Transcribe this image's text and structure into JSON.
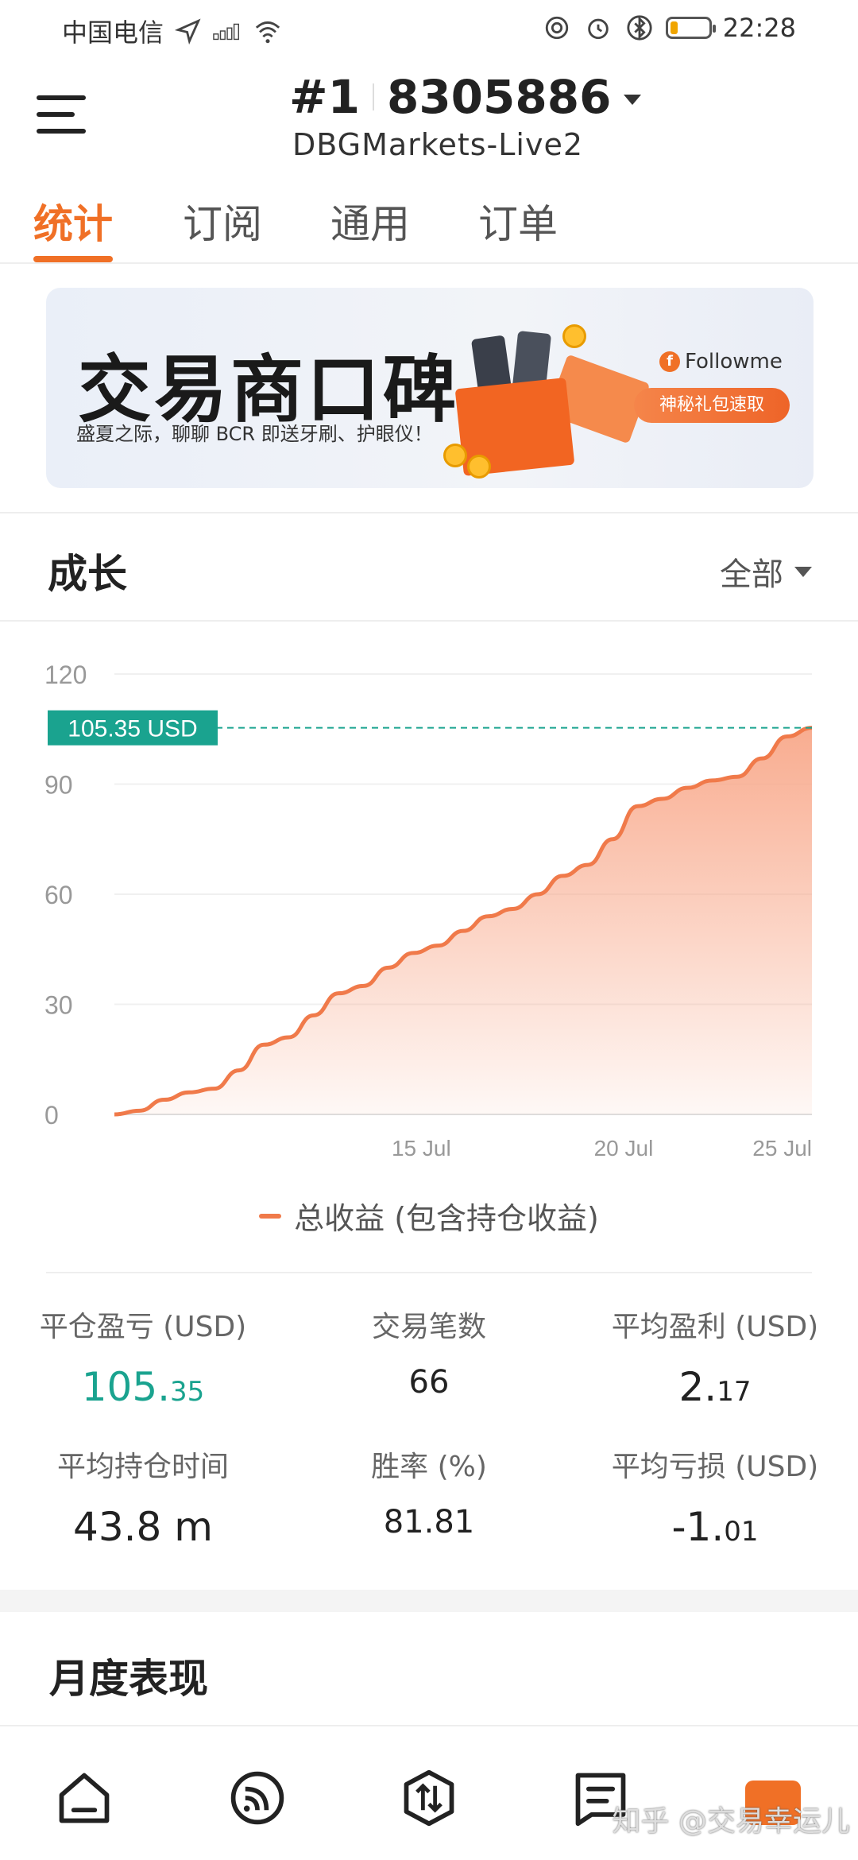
{
  "status_bar": {
    "carrier": "中国电信",
    "signal": "4G",
    "time": "22:28",
    "battery_level": 0.18
  },
  "header": {
    "account_rank": "#1",
    "account_number": "8305886",
    "server": "DBGMarkets-Live2"
  },
  "tabs": [
    {
      "label": "统计",
      "active": true
    },
    {
      "label": "订阅",
      "active": false
    },
    {
      "label": "通用",
      "active": false
    },
    {
      "label": "订单",
      "active": false
    }
  ],
  "banner": {
    "title": "交易商口碑",
    "subtitle": "盛夏之际，聊聊 BCR 即送牙刷、护眼仪！",
    "brand": "Followme",
    "button": "神秘礼包速取"
  },
  "growth": {
    "title": "成长",
    "filter": "全部"
  },
  "chart_data": {
    "type": "area",
    "ylim": [
      0,
      120
    ],
    "yticks": [
      "120",
      "90",
      "60",
      "30",
      "0"
    ],
    "xticks": [
      "15 Jul",
      "20 Jul",
      "25 Jul"
    ],
    "current_label": "105.35 USD",
    "series": [
      {
        "name": "总收益 (包含持仓收益)",
        "values": [
          0,
          1,
          4,
          6,
          7,
          12,
          19,
          21,
          27,
          33,
          35,
          40,
          44,
          46,
          50,
          54,
          56,
          60,
          65,
          68,
          75,
          84,
          86,
          89,
          91,
          92,
          97,
          103,
          105.35
        ]
      }
    ],
    "colors": {
      "line": "#f07a4a",
      "fill": "#f8a88a",
      "marker": "#1aa38f"
    },
    "grid": true,
    "legend_position": "bottom-center"
  },
  "stats": {
    "closed_pl_label": "平仓盈亏 (USD)",
    "closed_pl_int": "105.",
    "closed_pl_dec": "35",
    "trades_label": "交易笔数",
    "trades_value": "66",
    "avg_profit_label": "平均盈利 (USD)",
    "avg_profit_int": "2.",
    "avg_profit_dec": "17",
    "avg_hold_label": "平均持仓时间",
    "avg_hold_value": "43.8 m",
    "winrate_label": "胜率 (%)",
    "winrate_value": "81.81",
    "avg_loss_label": "平均亏损 (USD)",
    "avg_loss_int": "-1.",
    "avg_loss_dec": "01"
  },
  "monthly": {
    "title": "月度表现"
  },
  "bottom_nav": {
    "icons": [
      "home-icon",
      "feed-icon",
      "trade-icon",
      "orders-icon",
      "profile-icon"
    ],
    "watermark": "知乎 @交易幸运儿"
  }
}
